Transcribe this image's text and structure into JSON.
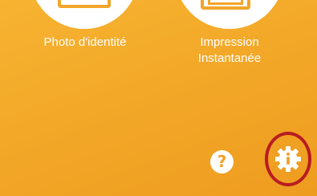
{
  "tiles": [
    {
      "label": "Photo d'identité",
      "icon": "id-photo-icon"
    },
    {
      "label_line1": "Impression",
      "label_line2": "Instantanée",
      "icon": "instant-print-icon"
    }
  ],
  "help_button": {
    "glyph": "?",
    "icon": "help-icon"
  },
  "info_button": {
    "icon": "info-gear-icon",
    "highlight_color": "#b81c22"
  },
  "colors": {
    "background": "#f3a828",
    "accent_dark": "#b81c22",
    "icon_fill": "#ffffff"
  }
}
